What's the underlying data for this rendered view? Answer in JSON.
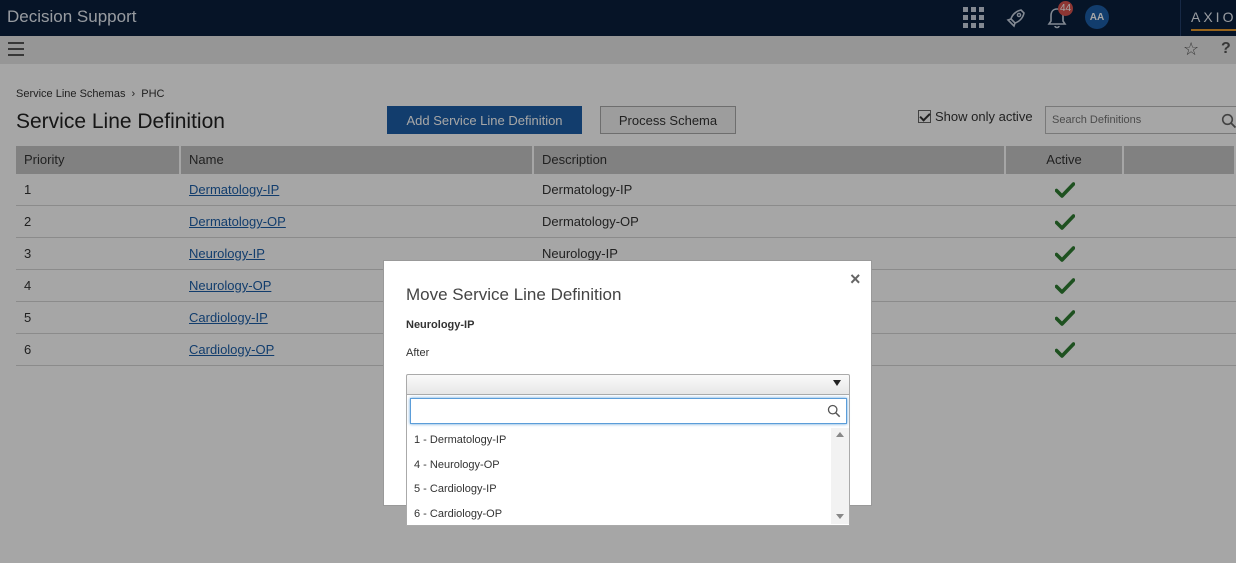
{
  "topbar": {
    "app_title": "Decision Support",
    "notification_count": "44",
    "avatar_initials": "AA",
    "brand": "AXIOM"
  },
  "breadcrumb": {
    "items": [
      "Service Line Schemas",
      "PHC"
    ],
    "separator": "›"
  },
  "page": {
    "title": "Service Line Definition",
    "add_button_label": "Add Service Line Definition",
    "process_button_label": "Process Schema",
    "show_only_active_label": "Show only active",
    "show_only_active_checked": true,
    "search_placeholder": "Search Definitions"
  },
  "table": {
    "columns": [
      "Priority",
      "Name",
      "Description",
      "Active",
      ""
    ],
    "rows": [
      {
        "priority": "1",
        "name": "Dermatology-IP",
        "description": "Dermatology-IP",
        "active": true
      },
      {
        "priority": "2",
        "name": "Dermatology-OP",
        "description": "Dermatology-OP",
        "active": true
      },
      {
        "priority": "3",
        "name": "Neurology-IP",
        "description": "Neurology-IP",
        "active": true
      },
      {
        "priority": "4",
        "name": "Neurology-OP",
        "description": "",
        "active": true
      },
      {
        "priority": "5",
        "name": "Cardiology-IP",
        "description": "",
        "active": true
      },
      {
        "priority": "6",
        "name": "Cardiology-OP",
        "description": "",
        "active": true
      }
    ]
  },
  "modal": {
    "title": "Move Service Line Definition",
    "item_name": "Neurology-IP",
    "after_label": "After",
    "selected_value": "",
    "close_glyph": "×"
  },
  "dropdown": {
    "search_value": "",
    "options": [
      "1 - Dermatology-IP",
      "4 - Neurology-OP",
      "5 - Cardiology-IP",
      "6 - Cardiology-OP"
    ]
  },
  "colors": {
    "topbar": "#0a1f3d",
    "primary": "#1d5fa8",
    "active_check": "#2e7d32",
    "brand_accent": "#e89a2b"
  }
}
